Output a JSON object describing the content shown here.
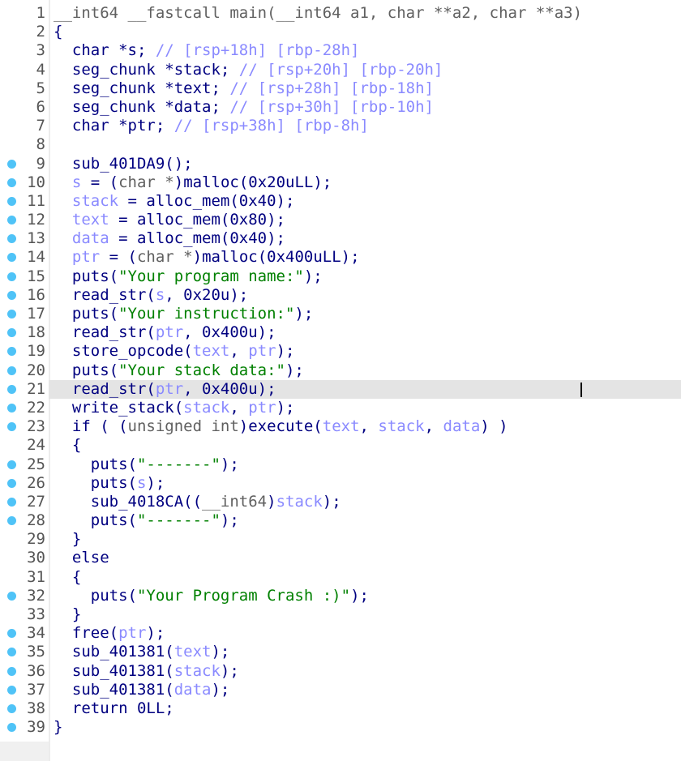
{
  "editor": {
    "highlighted_line": 21,
    "breakpoint_color": "#4fc3f7",
    "lines": [
      {
        "n": "1",
        "dot": false,
        "t": [
          [
            "__int64 __fastcall main(__int64 a1, char **a2, char **a3)",
            "k"
          ]
        ]
      },
      {
        "n": "2",
        "dot": false,
        "t": [
          [
            "{",
            "i"
          ]
        ]
      },
      {
        "n": "3",
        "dot": false,
        "t": [
          [
            "  char *s; ",
            "i"
          ],
          [
            "// [rsp+18h] [rbp-28h]",
            "c"
          ]
        ]
      },
      {
        "n": "4",
        "dot": false,
        "t": [
          [
            "  seg_chunk *stack; ",
            "i"
          ],
          [
            "// [rsp+20h] [rbp-20h]",
            "c"
          ]
        ]
      },
      {
        "n": "5",
        "dot": false,
        "t": [
          [
            "  seg_chunk *text; ",
            "i"
          ],
          [
            "// [rsp+28h] [rbp-18h]",
            "c"
          ]
        ]
      },
      {
        "n": "6",
        "dot": false,
        "t": [
          [
            "  seg_chunk *data; ",
            "i"
          ],
          [
            "// [rsp+30h] [rbp-10h]",
            "c"
          ]
        ]
      },
      {
        "n": "7",
        "dot": false,
        "t": [
          [
            "  char *ptr; ",
            "i"
          ],
          [
            "// [rsp+38h] [rbp-8h]",
            "c"
          ]
        ]
      },
      {
        "n": "8",
        "dot": false,
        "t": []
      },
      {
        "n": "9",
        "dot": true,
        "t": [
          [
            "  sub_401DA9();",
            "i"
          ]
        ]
      },
      {
        "n": "10",
        "dot": true,
        "t": [
          [
            "  ",
            "i"
          ],
          [
            "s",
            "v"
          ],
          [
            " = (",
            "i"
          ],
          [
            "char *",
            "k"
          ],
          [
            ")malloc(0x20uLL);",
            "i"
          ]
        ]
      },
      {
        "n": "11",
        "dot": true,
        "t": [
          [
            "  ",
            "i"
          ],
          [
            "stack",
            "v"
          ],
          [
            " = alloc_mem(0x40);",
            "i"
          ]
        ]
      },
      {
        "n": "12",
        "dot": true,
        "t": [
          [
            "  ",
            "i"
          ],
          [
            "text",
            "v"
          ],
          [
            " = alloc_mem(0x80);",
            "i"
          ]
        ]
      },
      {
        "n": "13",
        "dot": true,
        "t": [
          [
            "  ",
            "i"
          ],
          [
            "data",
            "v"
          ],
          [
            " = alloc_mem(0x40);",
            "i"
          ]
        ]
      },
      {
        "n": "14",
        "dot": true,
        "t": [
          [
            "  ",
            "i"
          ],
          [
            "ptr",
            "v"
          ],
          [
            " = (",
            "i"
          ],
          [
            "char *",
            "k"
          ],
          [
            ")malloc(0x400uLL);",
            "i"
          ]
        ]
      },
      {
        "n": "15",
        "dot": true,
        "t": [
          [
            "  puts(",
            "i"
          ],
          [
            "\"Your program name:\"",
            "s"
          ],
          [
            ");",
            "i"
          ]
        ]
      },
      {
        "n": "16",
        "dot": true,
        "t": [
          [
            "  read_str(",
            "i"
          ],
          [
            "s",
            "v"
          ],
          [
            ", 0x20u);",
            "i"
          ]
        ]
      },
      {
        "n": "17",
        "dot": true,
        "t": [
          [
            "  puts(",
            "i"
          ],
          [
            "\"Your instruction:\"",
            "s"
          ],
          [
            ");",
            "i"
          ]
        ]
      },
      {
        "n": "18",
        "dot": true,
        "t": [
          [
            "  read_str(",
            "i"
          ],
          [
            "ptr",
            "v"
          ],
          [
            ", 0x400u);",
            "i"
          ]
        ]
      },
      {
        "n": "19",
        "dot": true,
        "t": [
          [
            "  store_opcode(",
            "i"
          ],
          [
            "text",
            "v"
          ],
          [
            ", ",
            "i"
          ],
          [
            "ptr",
            "v"
          ],
          [
            ");",
            "i"
          ]
        ]
      },
      {
        "n": "20",
        "dot": true,
        "t": [
          [
            "  puts(",
            "i"
          ],
          [
            "\"Your stack data:\"",
            "s"
          ],
          [
            ");",
            "i"
          ]
        ]
      },
      {
        "n": "21",
        "dot": true,
        "t": [
          [
            "  read_str(",
            "i"
          ],
          [
            "ptr",
            "v"
          ],
          [
            ", 0x400u);",
            "i"
          ]
        ]
      },
      {
        "n": "22",
        "dot": true,
        "t": [
          [
            "  write_stack(",
            "i"
          ],
          [
            "stack",
            "v"
          ],
          [
            ", ",
            "i"
          ],
          [
            "ptr",
            "v"
          ],
          [
            ");",
            "i"
          ]
        ]
      },
      {
        "n": "23",
        "dot": true,
        "t": [
          [
            "  if ( (",
            "i"
          ],
          [
            "unsigned int",
            "k"
          ],
          [
            ")execute(",
            "i"
          ],
          [
            "text",
            "v"
          ],
          [
            ", ",
            "i"
          ],
          [
            "stack",
            "v"
          ],
          [
            ", ",
            "i"
          ],
          [
            "data",
            "v"
          ],
          [
            ") )",
            "i"
          ]
        ]
      },
      {
        "n": "24",
        "dot": false,
        "t": [
          [
            "  {",
            "i"
          ]
        ]
      },
      {
        "n": "25",
        "dot": true,
        "t": [
          [
            "    puts(",
            "i"
          ],
          [
            "\"-------\"",
            "s"
          ],
          [
            ");",
            "i"
          ]
        ]
      },
      {
        "n": "26",
        "dot": true,
        "t": [
          [
            "    puts(",
            "i"
          ],
          [
            "s",
            "v"
          ],
          [
            ");",
            "i"
          ]
        ]
      },
      {
        "n": "27",
        "dot": true,
        "t": [
          [
            "    sub_4018CA((",
            "i"
          ],
          [
            "__int64",
            "k"
          ],
          [
            ")",
            "i"
          ],
          [
            "stack",
            "v"
          ],
          [
            ");",
            "i"
          ]
        ]
      },
      {
        "n": "28",
        "dot": true,
        "t": [
          [
            "    puts(",
            "i"
          ],
          [
            "\"-------\"",
            "s"
          ],
          [
            ");",
            "i"
          ]
        ]
      },
      {
        "n": "29",
        "dot": false,
        "t": [
          [
            "  }",
            "i"
          ]
        ]
      },
      {
        "n": "30",
        "dot": false,
        "t": [
          [
            "  else",
            "i"
          ]
        ]
      },
      {
        "n": "31",
        "dot": false,
        "t": [
          [
            "  {",
            "i"
          ]
        ]
      },
      {
        "n": "32",
        "dot": true,
        "t": [
          [
            "    puts(",
            "i"
          ],
          [
            "\"Your Program Crash :)\"",
            "s"
          ],
          [
            ");",
            "i"
          ]
        ]
      },
      {
        "n": "33",
        "dot": false,
        "t": [
          [
            "  }",
            "i"
          ]
        ]
      },
      {
        "n": "34",
        "dot": true,
        "t": [
          [
            "  free(",
            "i"
          ],
          [
            "ptr",
            "v"
          ],
          [
            ");",
            "i"
          ]
        ]
      },
      {
        "n": "35",
        "dot": true,
        "t": [
          [
            "  sub_401381(",
            "i"
          ],
          [
            "text",
            "v"
          ],
          [
            ");",
            "i"
          ]
        ]
      },
      {
        "n": "36",
        "dot": true,
        "t": [
          [
            "  sub_401381(",
            "i"
          ],
          [
            "stack",
            "v"
          ],
          [
            ");",
            "i"
          ]
        ]
      },
      {
        "n": "37",
        "dot": true,
        "t": [
          [
            "  sub_401381(",
            "i"
          ],
          [
            "data",
            "v"
          ],
          [
            ");",
            "i"
          ]
        ]
      },
      {
        "n": "38",
        "dot": true,
        "t": [
          [
            "  return 0LL;",
            "i"
          ]
        ]
      },
      {
        "n": "39",
        "dot": true,
        "t": [
          [
            "}",
            "i"
          ]
        ]
      }
    ]
  }
}
